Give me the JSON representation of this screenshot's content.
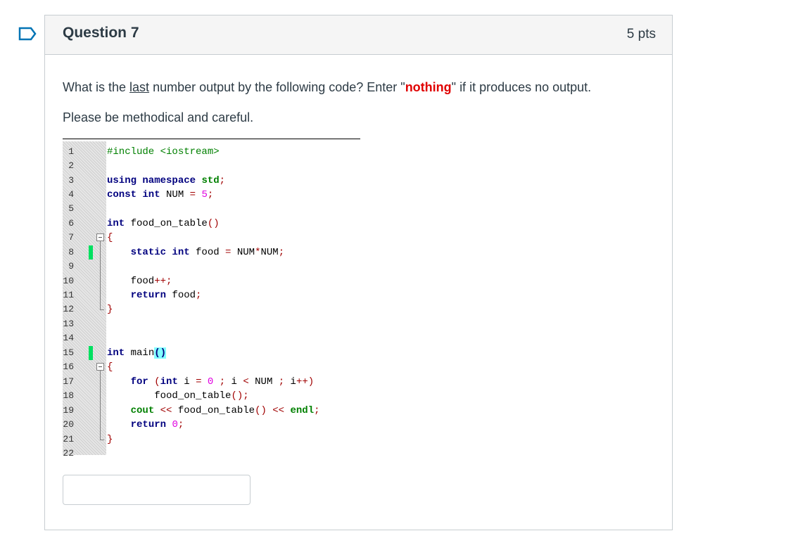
{
  "question": {
    "title": "Question 7",
    "points": "5 pts",
    "prompt_before": "What is the ",
    "prompt_underlined": "last",
    "prompt_middle": " number output by the following code?   Enter \"",
    "prompt_red": "nothing",
    "prompt_after": "\" if it produces no output.",
    "note": "Please be methodical and careful."
  },
  "code": {
    "line_numbers": [
      "1",
      "2",
      "3",
      "4",
      "5",
      "6",
      "7",
      "8",
      "9",
      "10",
      "11",
      "12",
      "13",
      "14",
      "15",
      "16",
      "17",
      "18",
      "19",
      "20",
      "21",
      "22"
    ]
  },
  "answer": {
    "value": "",
    "placeholder": ""
  },
  "colors": {
    "red_text": "#e00000",
    "keyword": "#00007f",
    "marker": "#00e060",
    "highlight": "#80ffff"
  }
}
